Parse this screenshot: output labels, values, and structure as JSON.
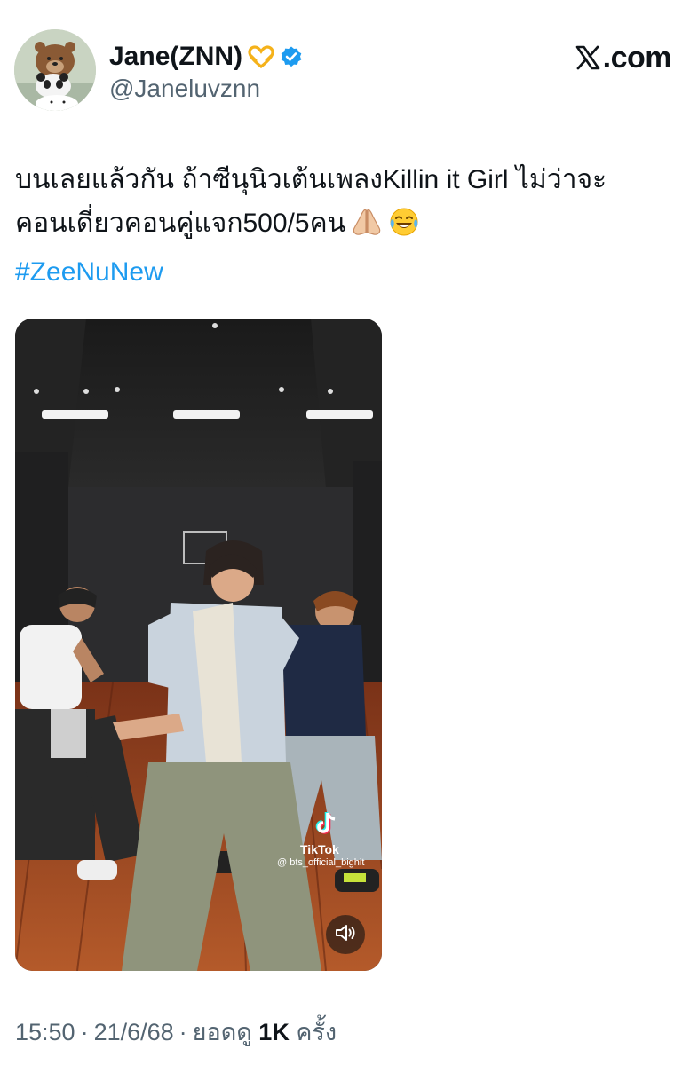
{
  "author": {
    "display_name": "Jane(ZNN)",
    "handle": "@Janeluvznn",
    "name_emoji_icon": "heart-hands-icon",
    "verified_icon": "verified-badge-icon",
    "verified_color": "#1d9bf0"
  },
  "brand": {
    "x_icon": "x-logo-icon",
    "domain": ".com"
  },
  "tweet": {
    "line1": "บนเลยแล้วกัน ถ้าซีนุนิวเต้นเพลงKillin it Girl ไม่ว่าจะ",
    "line2": "คอนเดี่ยวคอนคู่แจก500/5คน",
    "emojis": [
      "folded-hands-icon",
      "tears-of-joy-icon"
    ],
    "hashtag": "#ZeeNuNew",
    "hashtag_color": "#1d9bf0"
  },
  "media": {
    "watermark_brand": "TikTok",
    "watermark_user": "@ bts_official_bighit",
    "volume_icon": "speaker-icon"
  },
  "meta": {
    "time": "15:50",
    "date": "21/6/68",
    "views_prefix": "ยอดดู",
    "views_count": "1K",
    "views_suffix": "ครั้ง",
    "separator": "·"
  },
  "colors": {
    "text": "#0f1419",
    "secondary": "#536471",
    "accent": "#1d9bf0"
  }
}
